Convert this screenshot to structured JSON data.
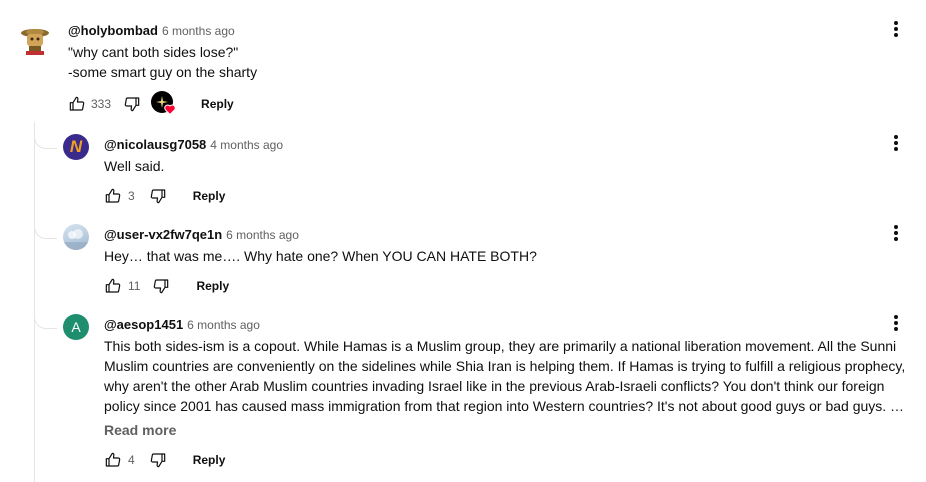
{
  "comments": [
    {
      "handle": "@holybombad",
      "time": "6 months ago",
      "lines": [
        "\"why cant both sides lose?\"",
        "-some smart guy on the sharty"
      ],
      "likes": "333",
      "reply_label": "Reply",
      "creator_heart": true
    }
  ],
  "replies": [
    {
      "handle": "@nicolausg7058",
      "time": "4 months ago",
      "text": "Well said.",
      "likes": "3",
      "reply_label": "Reply",
      "avatar_letter": "N"
    },
    {
      "handle": "@user-vx2fw7qe1n",
      "time": "6 months ago",
      "text": "Hey… that was me…. Why hate one? When YOU CAN HATE BOTH?",
      "likes": "11",
      "reply_label": "Reply"
    },
    {
      "handle": "@aesop1451",
      "time": "6 months ago",
      "lines": [
        "This both sides-ism is a copout. While Hamas is a Muslim group, they are primarily a national liberation movement. All the Sunni",
        "Muslim countries are conveniently on the sidelines while Shia Iran is helping them. If Hamas is trying to fulfill a religious prophecy,",
        "why aren't the other Arab Muslim countries invading Israel like in the previous Arab-Israeli conflicts? You don't think our foreign",
        "policy since 2001 has caused mass immigration from that region into Western countries? It's not about good guys or bad guys. …"
      ],
      "read_more": "Read more",
      "likes": "4",
      "reply_label": "Reply",
      "avatar_letter": "A"
    }
  ],
  "colors": {
    "avatar_a": "#1e8e6e",
    "heart": "#ff0033",
    "secondary_text": "#606060"
  }
}
